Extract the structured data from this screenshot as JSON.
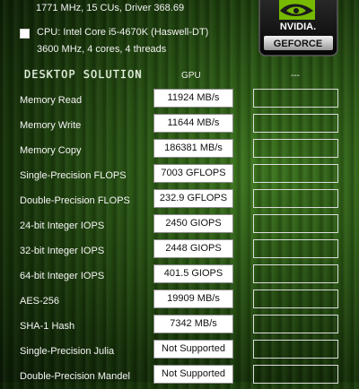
{
  "gpu_info": "1771 MHz, 15 CUs, Driver 368.69",
  "cpu": {
    "name": "CPU: Intel Core i5-4670K (Haswell-DT)",
    "details": "3600 MHz, 4 cores, 4 threads",
    "checked": false
  },
  "logo": {
    "brand": "NVIDIA.",
    "product": "GEFORCE"
  },
  "section_title": "DESKTOP SOLUTION",
  "columns": {
    "gpu": "GPU",
    "other": "---"
  },
  "results": [
    {
      "label": "Memory Read",
      "value": "11924 MB/s"
    },
    {
      "label": "Memory Write",
      "value": "11644 MB/s"
    },
    {
      "label": "Memory Copy",
      "value": "186381 MB/s"
    },
    {
      "label": "Single-Precision FLOPS",
      "value": "7003 GFLOPS"
    },
    {
      "label": "Double-Precision FLOPS",
      "value": "232.9 GFLOPS"
    },
    {
      "label": "24-bit Integer IOPS",
      "value": "2450 GIOPS"
    },
    {
      "label": "32-bit Integer IOPS",
      "value": "2448 GIOPS"
    },
    {
      "label": "64-bit Integer IOPS",
      "value": "401.5 GIOPS"
    },
    {
      "label": "AES-256",
      "value": "19909 MB/s"
    },
    {
      "label": "SHA-1 Hash",
      "value": "7342 MB/s"
    },
    {
      "label": "Single-Precision Julia",
      "value": "Not Supported"
    },
    {
      "label": "Double-Precision Mandel",
      "value": "Not Supported"
    }
  ]
}
